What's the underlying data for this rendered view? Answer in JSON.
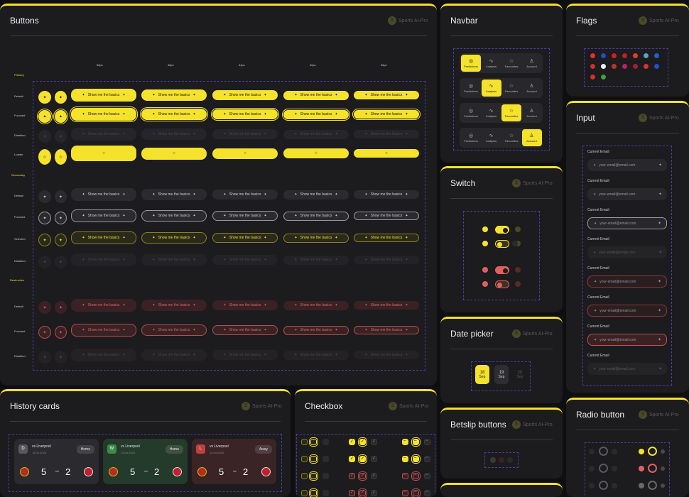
{
  "brand": "Sports AI-Pro",
  "buttons_panel": {
    "title": "Buttons",
    "columns": [
      "56px",
      "48px",
      "44px",
      "40px",
      "36px"
    ],
    "sections": {
      "primary": "Primary",
      "secondary": "Secondary",
      "destructive": "Destructive"
    },
    "states": {
      "default": "Default",
      "focused": "Focused",
      "disabled": "Disabled",
      "loader": "Loader",
      "selected": "Selected"
    },
    "button_label": "Show me the basics"
  },
  "navbar_panel": {
    "title": "Navbar",
    "items": [
      "Predictions",
      "Analysis",
      "Favourites",
      "Account"
    ]
  },
  "flags_panel": {
    "title": "Flags",
    "colors": [
      "#e03030",
      "#2050c0",
      "#d02020",
      "#c02020",
      "#e04020",
      "#5aa0d0",
      "#2060d0",
      "#d03030",
      "#f0f0f0",
      "#c03030",
      "#c02060",
      "#a02030",
      "#e03030",
      "#2050d0",
      "#d03030",
      "#40a040"
    ]
  },
  "input_panel": {
    "title": "Input",
    "label": "Current Email",
    "placeholder": "your-email@email.com"
  },
  "switch_panel": {
    "title": "Switch"
  },
  "date_panel": {
    "title": "Date picker",
    "dates": [
      {
        "day": "18",
        "month": "Sep"
      },
      {
        "day": "19",
        "month": "Sep"
      },
      {
        "day": "20",
        "month": "Sep"
      }
    ]
  },
  "betslip_panel": {
    "title": "Betslip buttons"
  },
  "radio_panel": {
    "title": "Radio button"
  },
  "checkbox_panel": {
    "title": "Checkbox"
  },
  "history_panel": {
    "title": "History cards",
    "cards": [
      {
        "badge": "D",
        "opponent": "vs Liverpool",
        "date": "13.04.2024",
        "venue": "Home",
        "home_score": "5",
        "away_score": "2"
      },
      {
        "badge": "W",
        "opponent": "vs Liverpool",
        "date": "13.04.2024",
        "venue": "Home",
        "home_score": "5",
        "away_score": "2"
      },
      {
        "badge": "L",
        "opponent": "vs Liverpool",
        "date": "13.04.2024",
        "venue": "Away",
        "home_score": "5",
        "away_score": "2"
      }
    ]
  }
}
